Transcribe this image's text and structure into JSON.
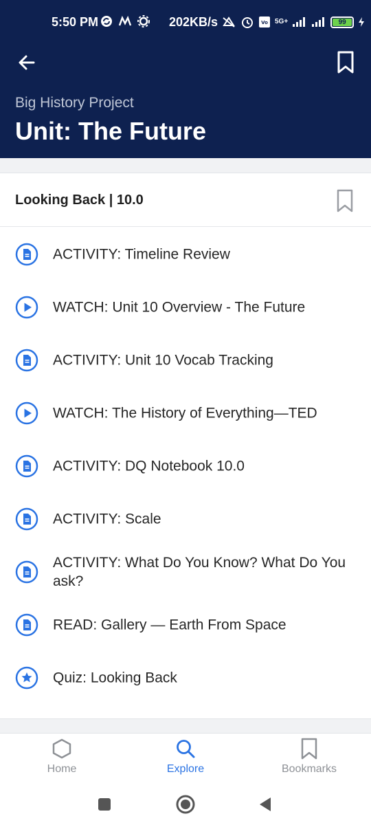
{
  "status_bar": {
    "time": "5:50 PM",
    "network_speed": "202KB/s",
    "battery_level": "99",
    "network_type": "5G+"
  },
  "header": {
    "subtitle": "Big History Project",
    "title": "Unit: The Future"
  },
  "section": {
    "title": "Looking Back | 10.0",
    "items": [
      {
        "icon": "document-icon",
        "label": "ACTIVITY: Timeline Review"
      },
      {
        "icon": "play-icon",
        "label": "WATCH: Unit 10 Overview - The Future"
      },
      {
        "icon": "document-icon",
        "label": "ACTIVITY: Unit 10 Vocab Tracking"
      },
      {
        "icon": "play-icon",
        "label": "WATCH: The History of Everything—TED"
      },
      {
        "icon": "document-icon",
        "label": "ACTIVITY: DQ Notebook 10.0"
      },
      {
        "icon": "document-icon",
        "label": "ACTIVITY: Scale"
      },
      {
        "icon": "document-icon",
        "label": "ACTIVITY: What Do You Know? What Do You ask?"
      },
      {
        "icon": "document-icon",
        "label": "READ: Gallery — Earth From Space"
      },
      {
        "icon": "star-icon",
        "label": "Quiz: Looking Back"
      }
    ]
  },
  "tabs": [
    {
      "label": "Home",
      "icon": "hexagon-icon",
      "active": false
    },
    {
      "label": "Explore",
      "icon": "search-icon",
      "active": true
    },
    {
      "label": "Bookmarks",
      "icon": "bookmark-icon",
      "active": false
    }
  ],
  "colors": {
    "header_bg": "#0e2150",
    "accent": "#2a73e3",
    "inactive": "#8e9196"
  }
}
